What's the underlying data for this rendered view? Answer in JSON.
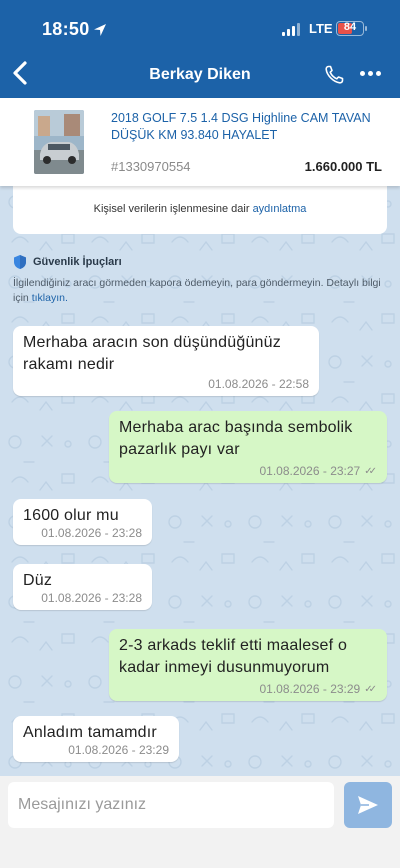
{
  "status_bar": {
    "time": "18:50",
    "network": "LTE",
    "battery": "84"
  },
  "header": {
    "title": "Berkay Diken"
  },
  "listing": {
    "title": "2018 GOLF 7.5 1.4 DSG Highline CAM TAVAN DÜŞÜK KM 93.840 HAYALET",
    "id": "#1330970554",
    "price": "1.660.000 TL"
  },
  "info_card": {
    "text": "Kişisel verilerin işlenmesine dair",
    "link": "aydınlatma"
  },
  "safety": {
    "title": "Güvenlik İpuçları",
    "body": "İlgilendiğiniz aracı görmeden kapora ödemeyin, para göndermeyin. Detaylı bilgi için",
    "link": "tıklayın."
  },
  "messages": [
    {
      "direction": "in",
      "text": "Merhaba aracın son düşündüğünüz rakamı nedir",
      "time": "01.08.2026 - 22:58"
    },
    {
      "direction": "out",
      "text": "Merhaba arac başında sembolik pazarlık payı var",
      "time": "01.08.2026 - 23:27"
    },
    {
      "direction": "in",
      "text": "1600 olur mu",
      "time": "01.08.2026 - 23:28"
    },
    {
      "direction": "in",
      "text": "Düz",
      "time": "01.08.2026 - 23:28"
    },
    {
      "direction": "out",
      "text": "2-3 arkads teklif etti maalesef o kadar inmeyi dusunmuyorum",
      "time": "01.08.2026 - 23:29"
    },
    {
      "direction": "in",
      "text": "Anladım tamamdır",
      "time": "01.08.2026 - 23:29"
    }
  ],
  "composer": {
    "placeholder": "Mesajınızı yazınız"
  },
  "colors": {
    "header": "#1c62a8",
    "chat_bg": "#cfdfee",
    "out_bubble": "#d6f7c6",
    "in_bubble": "#ffffff",
    "link": "#1c62a8"
  },
  "icons": [
    "location-arrow-icon",
    "signal-icon",
    "battery-icon",
    "back-chevron-icon",
    "phone-icon",
    "more-dots-icon",
    "shield-icon",
    "double-check-icon",
    "send-icon"
  ]
}
